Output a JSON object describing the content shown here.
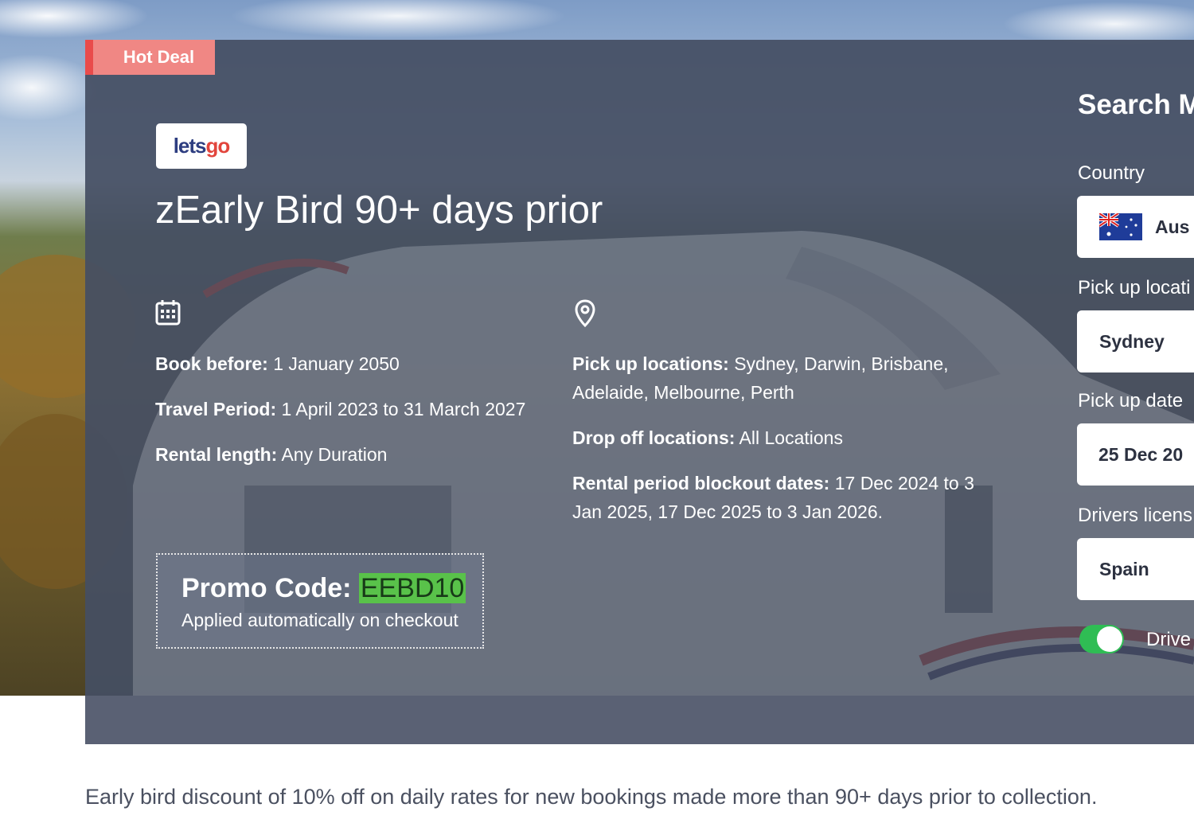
{
  "hero": {
    "badge": "Hot Deal",
    "logo": {
      "part1": "lets",
      "part2": "go"
    },
    "title": "zEarly Bird 90+ days prior",
    "left_info": [
      {
        "label": "Book before:",
        "value": " 1 January 2050"
      },
      {
        "label": "Travel Period:",
        "value": " 1 April 2023 to 31 March 2027"
      },
      {
        "label": "Rental length:",
        "value": " Any Duration"
      }
    ],
    "right_info": [
      {
        "label": "Pick up locations:",
        "value": " Sydney, Darwin, Brisbane, Adelaide, Melbourne, Perth"
      },
      {
        "label": "Drop off locations:",
        "value": " All Locations"
      },
      {
        "label": "Rental period blockout dates:",
        "value": " 17 Dec 2024 to 3 Jan 2025, 17 Dec 2025 to 3 Jan 2026."
      }
    ],
    "icons": {
      "left": "calendar-icon",
      "right": "map-pin-icon"
    },
    "promo": {
      "label": "Promo Code: ",
      "code": "EEBD10",
      "note": "Applied automatically on checkout",
      "code_highlight_color": "#59c24a"
    }
  },
  "search": {
    "title": "Search M",
    "country_label": "Country",
    "country_value": "Aus",
    "pickup_location_label": "Pick up locati",
    "pickup_location_value": "Sydney",
    "pickup_date_label": "Pick up date",
    "pickup_date_value": "25 Dec 20",
    "license_label": "Drivers licens",
    "license_value": "Spain",
    "toggle_label": "Drive",
    "toggle_on": true
  },
  "description": "Early bird discount of 10% off on daily rates for new bookings made more than 90+ days prior to collection.",
  "colors": {
    "badge": "#f08784",
    "panel": "#454f63",
    "toggle": "#2fbd54"
  }
}
